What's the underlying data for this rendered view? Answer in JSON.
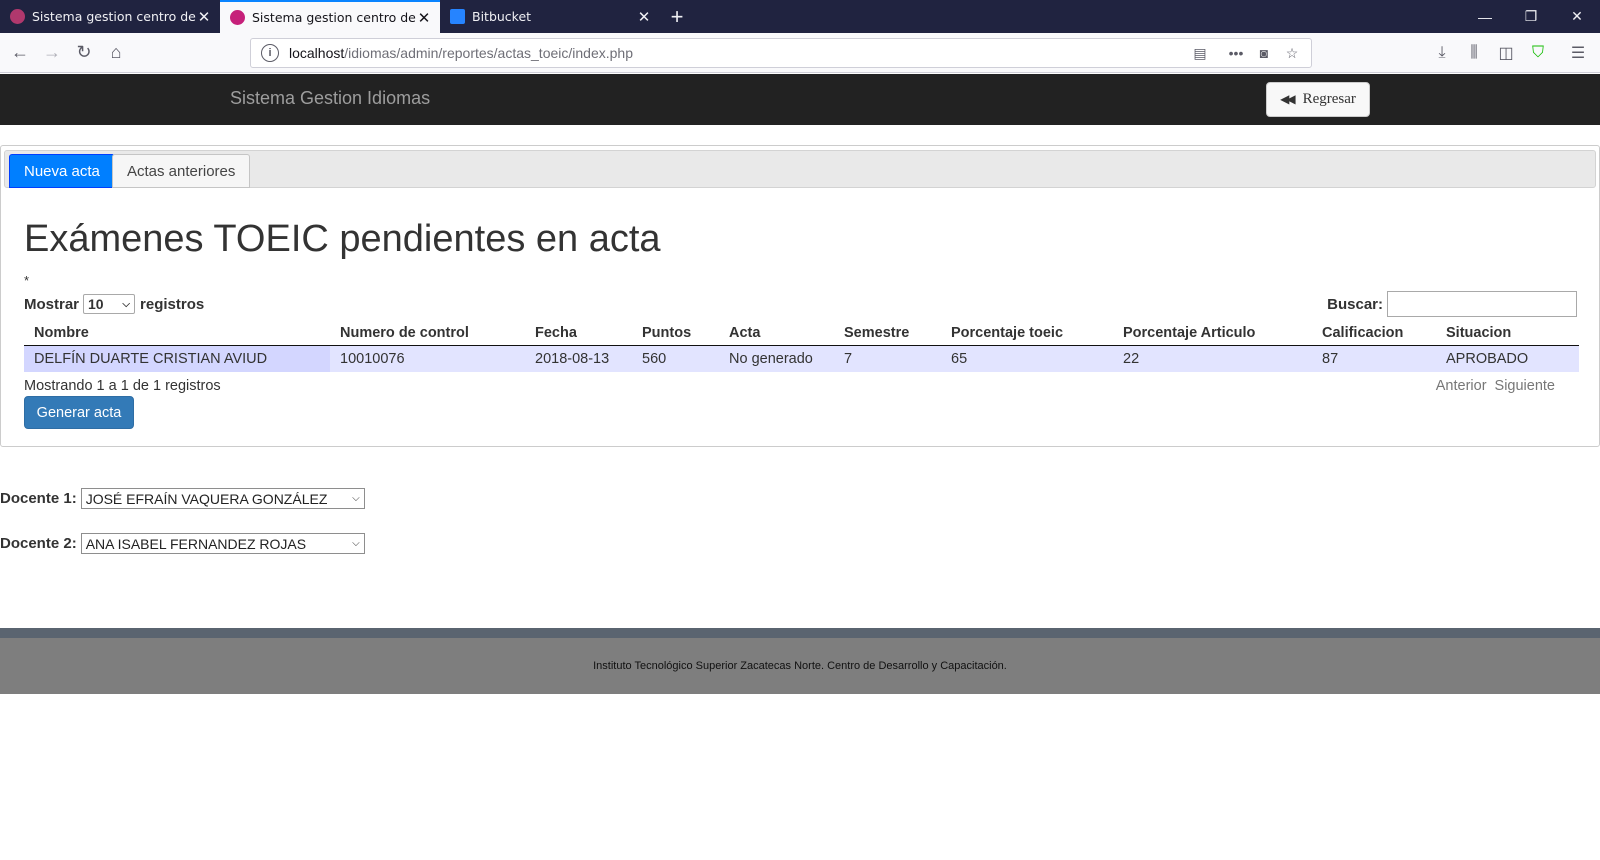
{
  "browser": {
    "tabs": [
      {
        "title": "Sistema gestion centro de idion",
        "active": false,
        "favicon_color": "#b0386d"
      },
      {
        "title": "Sistema gestion centro de idion",
        "active": true,
        "favicon_color": "#c6207a"
      },
      {
        "title": "Bitbucket",
        "active": false,
        "favicon_color": "#2684ff"
      }
    ],
    "url_host": "localhost",
    "url_path": "/idiomas/admin/reportes/actas_toeic/index.php"
  },
  "app": {
    "brand": "Sistema Gestion Idiomas",
    "back_button": "Regresar"
  },
  "panel": {
    "tabs": [
      "Nueva acta",
      "Actas anteriores"
    ],
    "heading": "Exámenes TOEIC pendientes en acta",
    "dot": "*",
    "show_label": "Mostrar",
    "show_value": "10",
    "show_suffix": "registros",
    "search_label": "Buscar:",
    "search_value": "",
    "columns": [
      "Nombre",
      "Numero de control",
      "Fecha",
      "Puntos",
      "Acta",
      "Semestre",
      "Porcentaje toeic",
      "Porcentaje Articulo",
      "Calificacion",
      "Situacion"
    ],
    "rows": [
      [
        "DELFÍN DUARTE CRISTIAN AVIUD",
        "10010076",
        "2018-08-13",
        "560",
        "No generado",
        "7",
        "65",
        "22",
        "87",
        "APROBADO"
      ]
    ],
    "info": "Mostrando 1 a 1 de 1 registros",
    "prev": "Anterior",
    "next": "Siguiente",
    "generate_button": "Generar acta"
  },
  "docentes": [
    {
      "label": "Docente 1:",
      "value": "JOSÉ EFRAÍN VAQUERA GONZÁLEZ"
    },
    {
      "label": "Docente 2:",
      "value": "ANA ISABEL FERNANDEZ ROJAS"
    }
  ],
  "footer": "Instituto Tecnológico Superior Zacatecas Norte. Centro de Desarrollo y Capacitación."
}
